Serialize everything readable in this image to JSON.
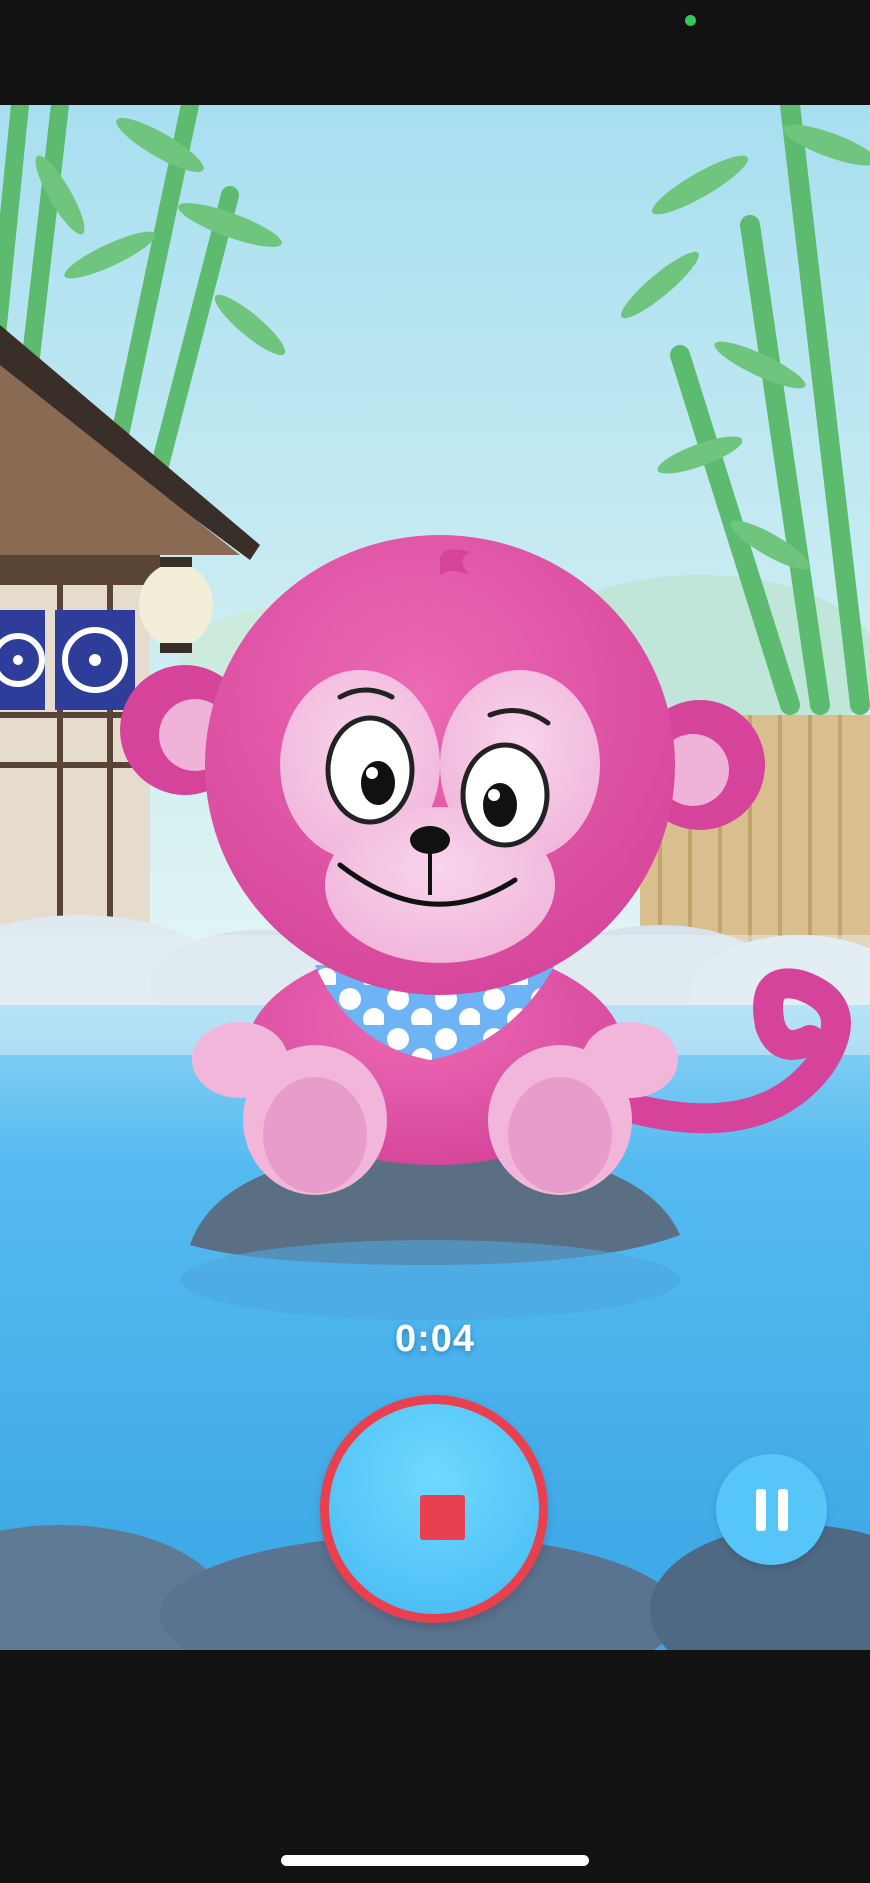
{
  "recording": {
    "elapsed_time": "0:04"
  },
  "controls": {
    "stop_icon": "stop-square-icon",
    "pause_icon": "pause-icon"
  },
  "colors": {
    "accent_red": "#e8404f",
    "button_blue": "#56c6f8",
    "water_blue": "#4cb1ea",
    "monkey_pink": "#e0509e",
    "status_dot_green": "#34c759"
  }
}
